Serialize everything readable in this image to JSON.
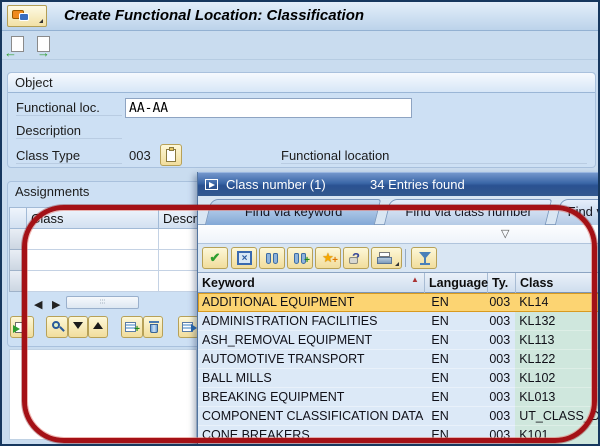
{
  "window": {
    "title": "Create Functional Location: Classification"
  },
  "object": {
    "section_title": "Object",
    "functional_loc_label": "Functional loc.",
    "functional_loc_value": "AA-AA",
    "description_label": "Description",
    "class_type_label": "Class Type",
    "class_type_value": "003",
    "class_type_text": "Functional location"
  },
  "assignments": {
    "section_title": "Assignments",
    "columns": {
      "class": "Class",
      "description": "Description"
    }
  },
  "popup": {
    "title": "Class number (1)",
    "entries_found": "34 Entries found",
    "tabs": [
      {
        "label": "Find via keyword"
      },
      {
        "label": "Find via class number"
      },
      {
        "label": "Find via"
      }
    ],
    "dropdown_glyph": "▽",
    "toolbar_icons": [
      "accept-icon",
      "cancel-icon",
      "find-icon",
      "find-next-icon",
      "favorites-add-icon",
      "help-icon",
      "print-icon",
      "filter-icon"
    ],
    "table": {
      "columns": {
        "keyword": "Keyword",
        "language": "Language",
        "type": "Ty.",
        "class": "Class"
      },
      "rows": [
        {
          "keyword": "ADDITIONAL EQUIPMENT",
          "language": "EN",
          "type": "003",
          "class": "KL14",
          "selected": true
        },
        {
          "keyword": "ADMINISTRATION FACILITIES",
          "language": "EN",
          "type": "003",
          "class": "KL132"
        },
        {
          "keyword": "ASH_REMOVAL EQUIPMENT",
          "language": "EN",
          "type": "003",
          "class": "KL113"
        },
        {
          "keyword": "AUTOMOTIVE TRANSPORT",
          "language": "EN",
          "type": "003",
          "class": "KL122"
        },
        {
          "keyword": "BALL MILLS",
          "language": "EN",
          "type": "003",
          "class": "KL102"
        },
        {
          "keyword": "BREAKING EQUIPMENT",
          "language": "EN",
          "type": "003",
          "class": "KL013"
        },
        {
          "keyword": "COMPONENT CLASSIFICATION DATA",
          "language": "EN",
          "type": "003",
          "class": "UT_CLASS_DA"
        },
        {
          "keyword": "CONE BREAKERS",
          "language": "EN",
          "type": "003",
          "class": "K101"
        }
      ]
    }
  },
  "glyphs": {
    "accept": "✔",
    "cancel": "×",
    "question": "?",
    "star": "★",
    "sort_up": "▲",
    "left": "◀",
    "right": "▶",
    "back_arrow": "←",
    "exit_arrow": "→",
    "thumb_dots": "∶∶∶"
  },
  "colors": {
    "background": "#c9dcef",
    "popup_title_gradient": [
      "#7396cc",
      "#2a5191"
    ],
    "selected_row": "#fcd472",
    "class_column": "#cfe7dd",
    "row_background": "#dce9f7",
    "button_yellow": "#f1dd9c",
    "annotation_red": "#a41116"
  }
}
